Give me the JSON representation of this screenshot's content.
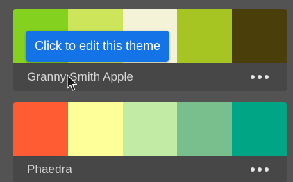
{
  "themes": [
    {
      "name": "Granny Smith Apple",
      "colors": [
        "#85d11f",
        "#cde55a",
        "#f4f3d8",
        "#a6c522",
        "#4a3f0a"
      ]
    },
    {
      "name": "Phaedra",
      "colors": [
        "#ff5c33",
        "#ffff9a",
        "#c2eca6",
        "#79bf8e",
        "#00a586"
      ]
    }
  ],
  "tooltip": {
    "text": "Click to edit this theme",
    "color": "#1473e6"
  },
  "icons": {
    "more": "more-options-icon",
    "cursor": "mouse-cursor-icon"
  }
}
